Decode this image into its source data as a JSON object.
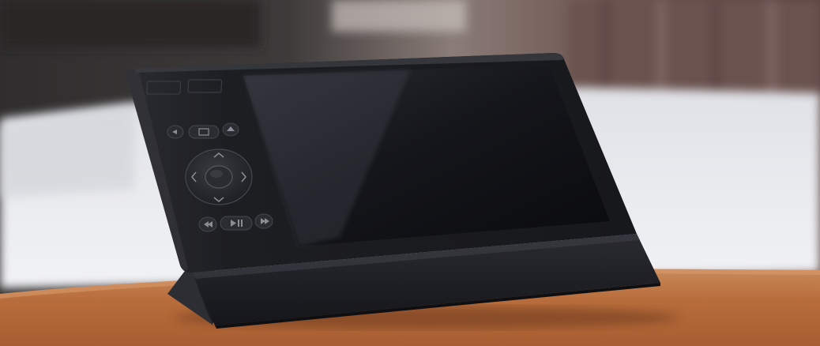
{
  "scene": {
    "subject": "remote-control-device",
    "colors": {
      "wall_dark": "#3a3737",
      "curtain": "#6d5450",
      "bedding": "#e9eaee",
      "table": "#b86d3c",
      "device_body": "#1a1b20",
      "screen": "#0d0e12",
      "dock": "#1c1d22",
      "button": "#2a2c31",
      "button_glyph": "#8a8d94"
    },
    "icons": {
      "top_left": "back-icon",
      "top_center": "menu-icon",
      "top_right": "home-icon",
      "dpad_up": "chevron-up-icon",
      "dpad_down": "chevron-down-icon",
      "dpad_left": "chevron-left-icon",
      "dpad_right": "chevron-right-icon",
      "dpad_center": "ok-button",
      "bottom_left": "rewind-icon",
      "bottom_center": "play-pause-icon",
      "bottom_right": "fast-forward-icon"
    }
  }
}
